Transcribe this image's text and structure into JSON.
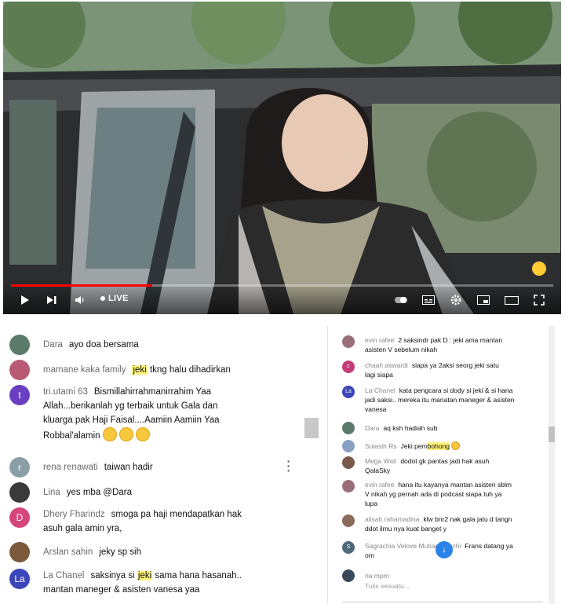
{
  "player": {
    "live_label": "LIVE",
    "progress_fraction": 0.26,
    "accent_color": "#ff0000",
    "icons": [
      "play-icon",
      "next-icon",
      "volume-icon",
      "subtitles-icon",
      "settings-icon",
      "miniplayer-icon",
      "theater-icon",
      "fullscreen-icon"
    ]
  },
  "left_chat": {
    "messages": [
      {
        "author": "Dara",
        "text": "ayo doa bersama",
        "avatar_color": "#5b7a6a",
        "avatar_letter": ""
      },
      {
        "author": "mamane kaka family",
        "highlight": "jeki",
        "text": "tkng halu dihadirkan",
        "avatar_color": "#b85a74",
        "avatar_letter": ""
      },
      {
        "author": "tri.utami 63",
        "text_line1": "Bismillahirrahmanirrahim Yaa",
        "text_line2": "Allah...berikanlah yg terbaik untuk Gala dan",
        "text_line3": "kluarga pak Haji Faisal....Aamiin Aamiin Yaa",
        "text_line4": "Robbal'alamin",
        "avatar_color": "#6a3fc2",
        "avatar_letter": "t"
      },
      {
        "author": "rena renawati",
        "text": "taiwan hadir",
        "avatar_color": "#8a9ea6",
        "avatar_letter": "r"
      },
      {
        "author": "Lina",
        "text": "yes mba @Dara",
        "avatar_color": "#3a3a3a",
        "avatar_letter": ""
      },
      {
        "author": "Dhery Fharindz",
        "text_line1": "smoga pa haji mendapatkan hak",
        "text_line2": "asuh gala amin yra,",
        "avatar_color": "#d6457a",
        "avatar_letter": "D"
      },
      {
        "author": "Arslan sahin",
        "text": "jeky sp sih",
        "avatar_color": "#7a5a3a",
        "avatar_letter": ""
      },
      {
        "author": "La Chanel",
        "text_pre": "saksinya si",
        "highlight": "jeki",
        "text_post": "sama hana hasanah..",
        "text_line2": "mantan maneger & asisten vanesa yaa",
        "avatar_color": "#3b46b8",
        "avatar_letter": "La"
      }
    ]
  },
  "right_chat": {
    "messages": [
      {
        "author": "evin rafee",
        "text": "2 saksindr pak D : jeki ama mantan",
        "text_line2": "asisten V sebelum nikah",
        "avatar_color": "#9a6e78",
        "avatar_letter": ""
      },
      {
        "author": "chaah aswardi",
        "text": "siapa ya 2aksi seorg jeki satu",
        "text_line2": "lagi siapa",
        "avatar_color": "#c43c7a",
        "avatar_letter": "c"
      },
      {
        "author": "La Chanel",
        "text": "kata pengcara si dody si jeki & si hana",
        "text_line2": "jadi saksi.. mereka itu manatan maneger & asisten",
        "text_line3": "vanesa",
        "avatar_color": "#3b46b8",
        "avatar_letter": "La"
      },
      {
        "author": "Dara",
        "text": "aq ksh hadiah sub",
        "avatar_color": "#5b7a6a",
        "avatar_letter": ""
      },
      {
        "author": "Sulasih Rs",
        "text_pre": "Jeki pem",
        "highlight": "bohong",
        "avatar_color": "#8aa0c2",
        "avatar_letter": ""
      },
      {
        "author": "Mega Wati",
        "text": "dodot gk pantas jadi hak asuh",
        "text_line2": "QalaSky",
        "avatar_color": "#7a5a4a",
        "avatar_letter": ""
      },
      {
        "author": "evin rafee",
        "text": "hana itu kayanya mantan asisten sblm",
        "text_line2": "V nikah yg pernah ada di podcast siapa tuh ya",
        "text_line3": "lupa",
        "avatar_color": "#9a6e78",
        "avatar_letter": ""
      },
      {
        "author": "alisah rahamadina",
        "text": "klw bnr2 nak gala jatu d tangn",
        "text_line2": "ddot ilmu nya kuat banget y",
        "avatar_color": "#8a6a5a",
        "avatar_letter": ""
      },
      {
        "author": "Sagrachia Velove Mutiara Ricchi",
        "text": "Frans datang ya",
        "text_line2": "om",
        "avatar_color": "#4f6a7a",
        "avatar_letter": "S"
      },
      {
        "author": "ria mpm",
        "text": "",
        "avatar_color": "#3a4a5a",
        "avatar_letter": ""
      }
    ],
    "input_placeholder": "Tulis sesuatu..."
  }
}
